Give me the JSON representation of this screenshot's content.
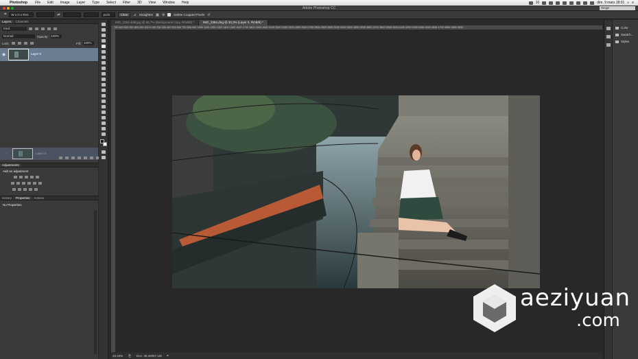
{
  "menubar": {
    "app_name": "Photoshop",
    "items": [
      "File",
      "Edit",
      "Image",
      "Layer",
      "Type",
      "Select",
      "Filter",
      "3D",
      "View",
      "Window",
      "Help"
    ],
    "status_text": "10",
    "clock": "dim. 9 mars 18:01"
  },
  "window": {
    "title": "Adobe Photoshop CC",
    "workspace": "Serge"
  },
  "options_bar": {
    "ratio_select": "W x H x Res.",
    "unit_select": "px/in",
    "clear_label": "Clear",
    "straighten_label": "Straighten",
    "delete_cropped_label": "Delete Cropped Pixels"
  },
  "layers_panel": {
    "tabs": [
      "Layers",
      "Channels"
    ],
    "kind_filter": "Kind",
    "blend_mode": "Normal",
    "opacity_label": "Opacity:",
    "opacity_value": "100%",
    "lock_label": "Lock:",
    "fill_label": "Fill:",
    "fill_value": "100%",
    "layers": [
      {
        "name": "Layer 0",
        "selected": true
      }
    ],
    "lower_layer_name": "Layer 0"
  },
  "adjustments_panel": {
    "tab": "Adjustments",
    "heading": "Add an adjustment"
  },
  "properties_panel": {
    "tabs": [
      "History",
      "Properties",
      "Actions"
    ],
    "message": "No Properties"
  },
  "document_tabs": [
    {
      "label": "IMG_0251-Edit.jpg @ 66,7% (Background copy, RGB/8) *",
      "active": false
    },
    {
      "label": "IMG_2384.dng @ 33,3% (Layer 0, RGB/8) *",
      "active": true
    }
  ],
  "ruler": {
    "ticks": "700 600 500 400 300 200 100 0 100 200 300 400 500 600 700 800 900 1000 1100 1200 1300 1400 1500 1600 1700 1800 1900 2000 2100 2200 2300 2400 2500 2600 2700 2800 2900 3000 3100 3200 3300 3400 3500 3600 3700 3800 3900 4000 4100 4200 4300 4400 4500 4600 4700 4800 4900 5000"
  },
  "status_bar": {
    "zoom": "33,33%",
    "doc_info": "Doc: 39,2M/57,1M"
  },
  "right_dock": {
    "items": [
      {
        "label": "Color",
        "icon": "color-wheel-icon"
      },
      {
        "label": "Swatch...",
        "icon": "swatches-icon"
      },
      {
        "label": "Styles",
        "icon": "styles-icon"
      }
    ]
  },
  "watermark": {
    "line1": "aeziyuan",
    "line2": ".com"
  },
  "colors": {
    "selected_layer": "#6b7d91",
    "panel_bg": "#3a3a3a",
    "canvas_bg": "#282828"
  }
}
